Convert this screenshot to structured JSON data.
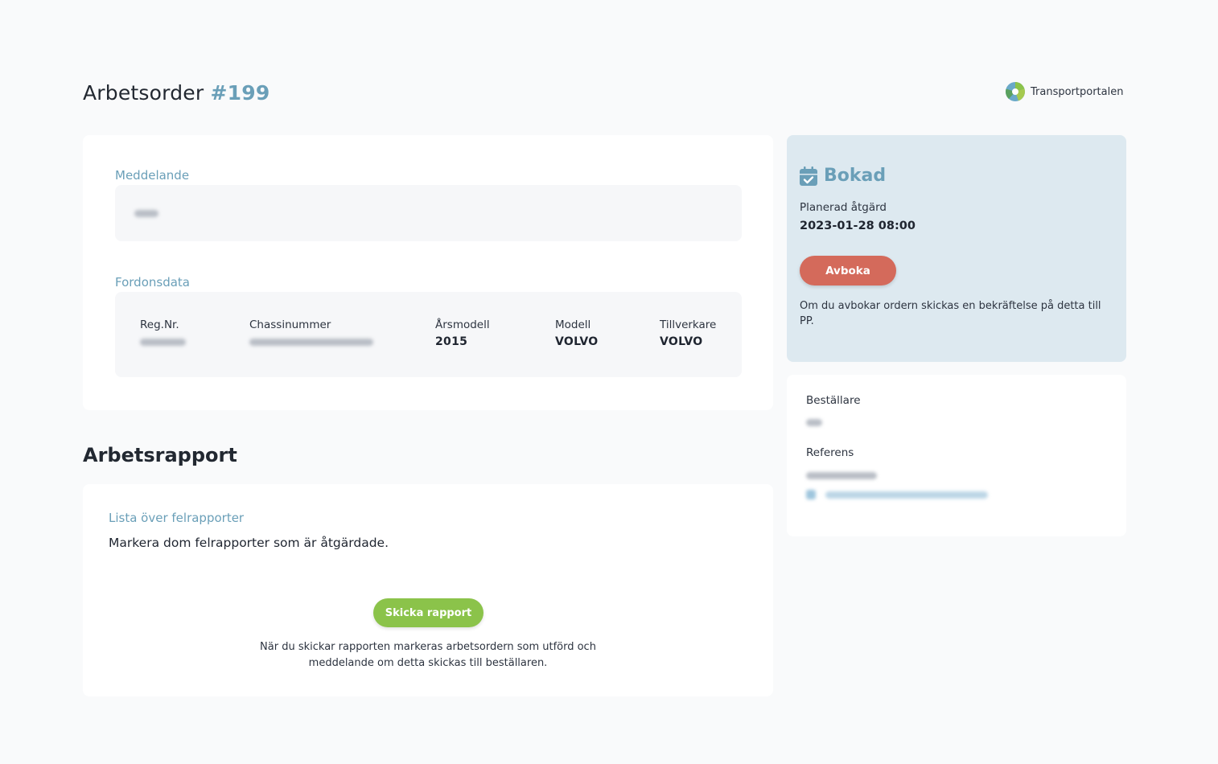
{
  "header": {
    "title": "Arbetsorder",
    "order_number": "#199",
    "brand": "Transportportalen"
  },
  "message": {
    "label": "Meddelande"
  },
  "vehicle": {
    "label": "Fordonsdata",
    "columns": [
      {
        "label": "Reg.Nr.",
        "value": null,
        "redacted": true
      },
      {
        "label": "Chassinummer",
        "value": null,
        "redacted": true
      },
      {
        "label": "Årsmodell",
        "value": "2015",
        "redacted": false
      },
      {
        "label": "Modell",
        "value": "VOLVO",
        "redacted": false
      },
      {
        "label": "Tillverkare",
        "value": "VOLVO",
        "redacted": false
      }
    ]
  },
  "report": {
    "title": "Arbetsrapport",
    "list_title": "Lista över felrapporter",
    "description": "Markera dom felrapporter som är åtgärdade.",
    "send_button": "Skicka rapport",
    "note": "När du skickar rapporten markeras arbetsordern som utförd och meddelande om detta skickas till beställaren."
  },
  "status": {
    "label": "Bokad",
    "icon": "calendar-check-icon",
    "planned_label": "Planerad åtgärd",
    "planned_date": "2023-01-28 08:00",
    "cancel_button": "Avboka",
    "cancel_note": "Om du avbokar ordern skickas en bekräftelse på detta till PP."
  },
  "info": {
    "orderer_label": "Beställare",
    "reference_label": "Referens"
  },
  "colors": {
    "accent": "#6a9fb8",
    "send_button": "#8bc34a",
    "cancel_button": "#d46a5b",
    "status_background": "#dde9f0",
    "page_background": "#f9fafb"
  }
}
